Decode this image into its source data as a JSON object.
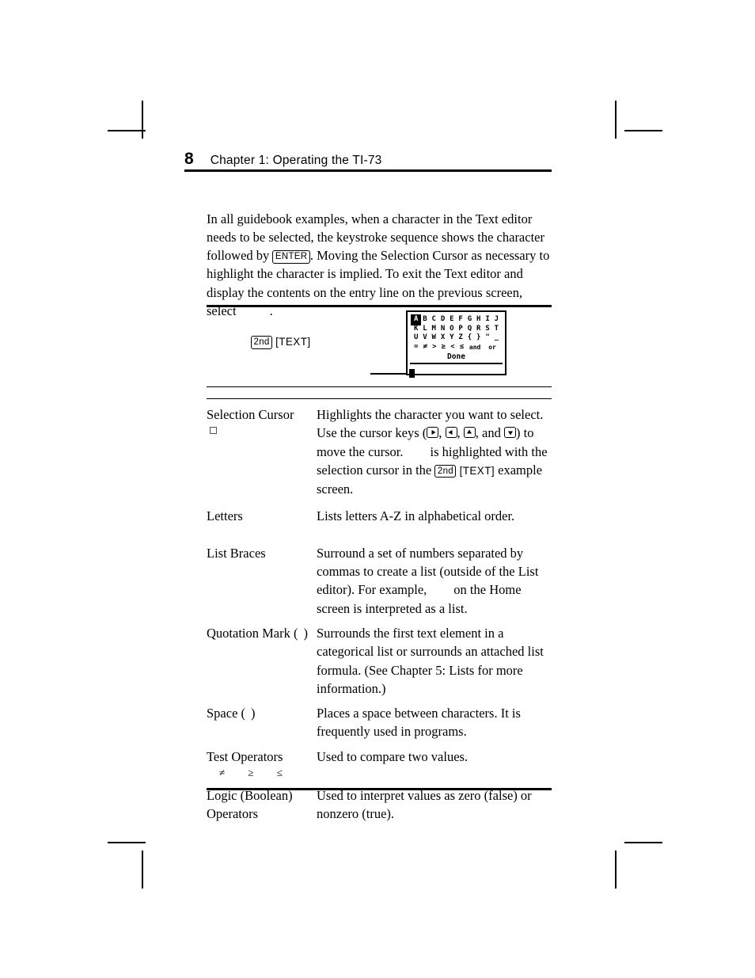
{
  "header": {
    "page_number": "8",
    "title": "Chapter 1: Operating the TI-73"
  },
  "body": {
    "paragraph_part1": "In all guidebook examples, when a character in the Text editor needs to be selected, the keystroke sequence shows the character followed by ",
    "enter_key": "ENTER",
    "paragraph_part2": ". Moving the Selection Cursor as necessary to highlight the character is implied. To exit the Text editor and display the contents on the entry line on the previous screen, select",
    "paragraph_part3": "."
  },
  "example": {
    "keystroke_second": "2nd",
    "keystroke_text": "[TEXT]",
    "calc_screen": {
      "row1": [
        "A",
        "B",
        "C",
        "D",
        "E",
        "F",
        "G",
        "H",
        "I",
        "J"
      ],
      "row1_selected_index": 0,
      "row2": [
        "K",
        "L",
        "M",
        "N",
        "O",
        "P",
        "Q",
        "R",
        "S",
        "T"
      ],
      "row3": [
        "U",
        "V",
        "W",
        "X",
        "Y",
        "Z",
        "{",
        "}",
        "\"",
        "_"
      ],
      "row4": [
        "=",
        "≠",
        ">",
        "≥",
        "<",
        "≤"
      ],
      "row4_words": [
        "and",
        "or"
      ],
      "done_label": "Done"
    }
  },
  "definitions": [
    {
      "term": "Selection Cursor",
      "term_symbol": "selection-cursor-square",
      "desc_part1": "Highlights the character you want to select. Use the cursor keys (",
      "desc_keys": [
        "right-arrow-key",
        "left-arrow-key",
        "up-arrow-key",
        "down-arrow-key"
      ],
      "desc_part2": ", and",
      "desc_part3": ") to move the cursor.",
      "desc_part4": "is highlighted with the selection cursor in the",
      "key_second": "2nd",
      "key_text": "[TEXT]",
      "desc_part5": "example screen."
    },
    {
      "term": "Letters",
      "desc": "Lists letters A-Z in alphabetical order."
    },
    {
      "term": "List Braces",
      "desc_part1": "Surround a set of numbers separated by commas to create a list (outside of the List editor). For example,",
      "desc_part2": "on the Home screen is interpreted as a list."
    },
    {
      "term": "Quotation Mark (",
      "term_close": ")",
      "desc": "Surrounds the first text element in a categorical list or surrounds an attached list formula. (See Chapter 5: Lists for more information.)"
    },
    {
      "term": "Space (",
      "term_close": ")",
      "desc": "Places a space between characters. It is frequently used in programs."
    },
    {
      "term": "Test Operators",
      "term_sub": "≠    ≥    ≤",
      "desc": "Used to compare two values."
    },
    {
      "term": "Logic (Boolean)",
      "term_line2": "Operators",
      "desc": "Used to interpret values as zero (false) or nonzero (true)."
    }
  ]
}
